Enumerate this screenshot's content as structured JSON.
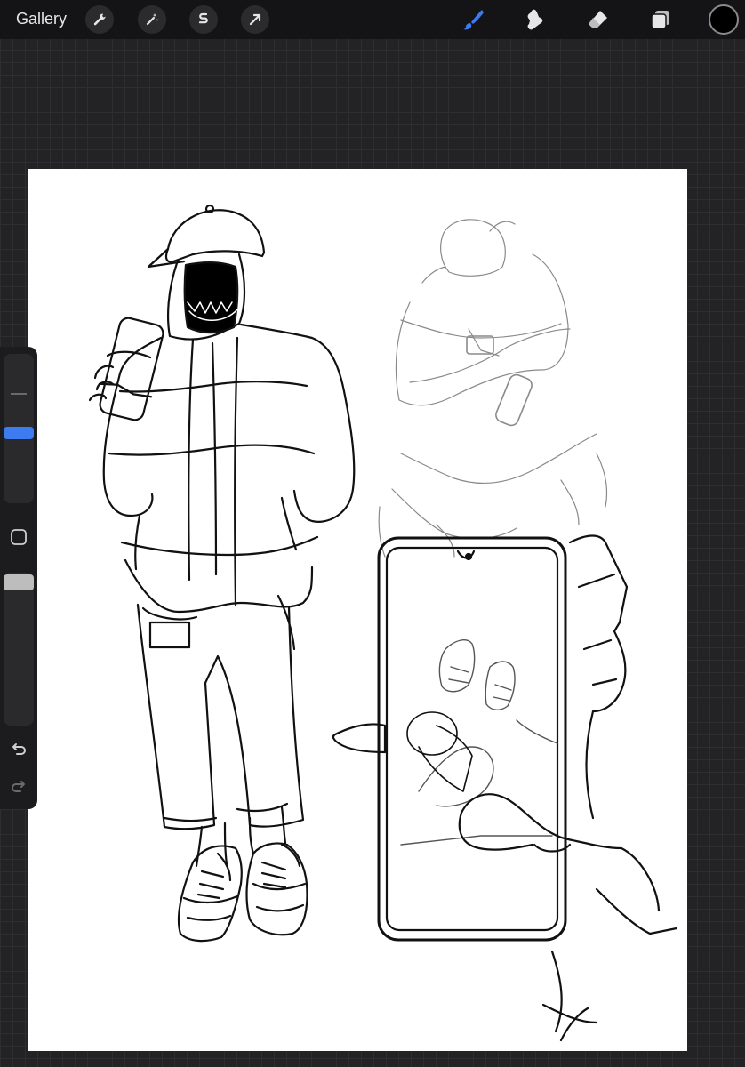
{
  "toolbar": {
    "gallery_label": "Gallery",
    "left_tools": [
      "wrench-icon",
      "magic-wand-icon",
      "selection-icon",
      "transform-arrow-icon"
    ],
    "right_tools": [
      "brush-icon",
      "smudge-icon",
      "eraser-icon",
      "layers-icon"
    ],
    "active_tool": "brush-icon",
    "accent_color": "#3d7bf0",
    "current_color": "#000000"
  },
  "sidebar": {
    "brush_size_level": 0.55,
    "opacity_level": 1.0,
    "modify_button": "square-icon",
    "undo": "undo-icon",
    "redo": "redo-icon"
  },
  "canvas": {
    "background": "#ffffff",
    "artwork": "line-art-illustration"
  }
}
